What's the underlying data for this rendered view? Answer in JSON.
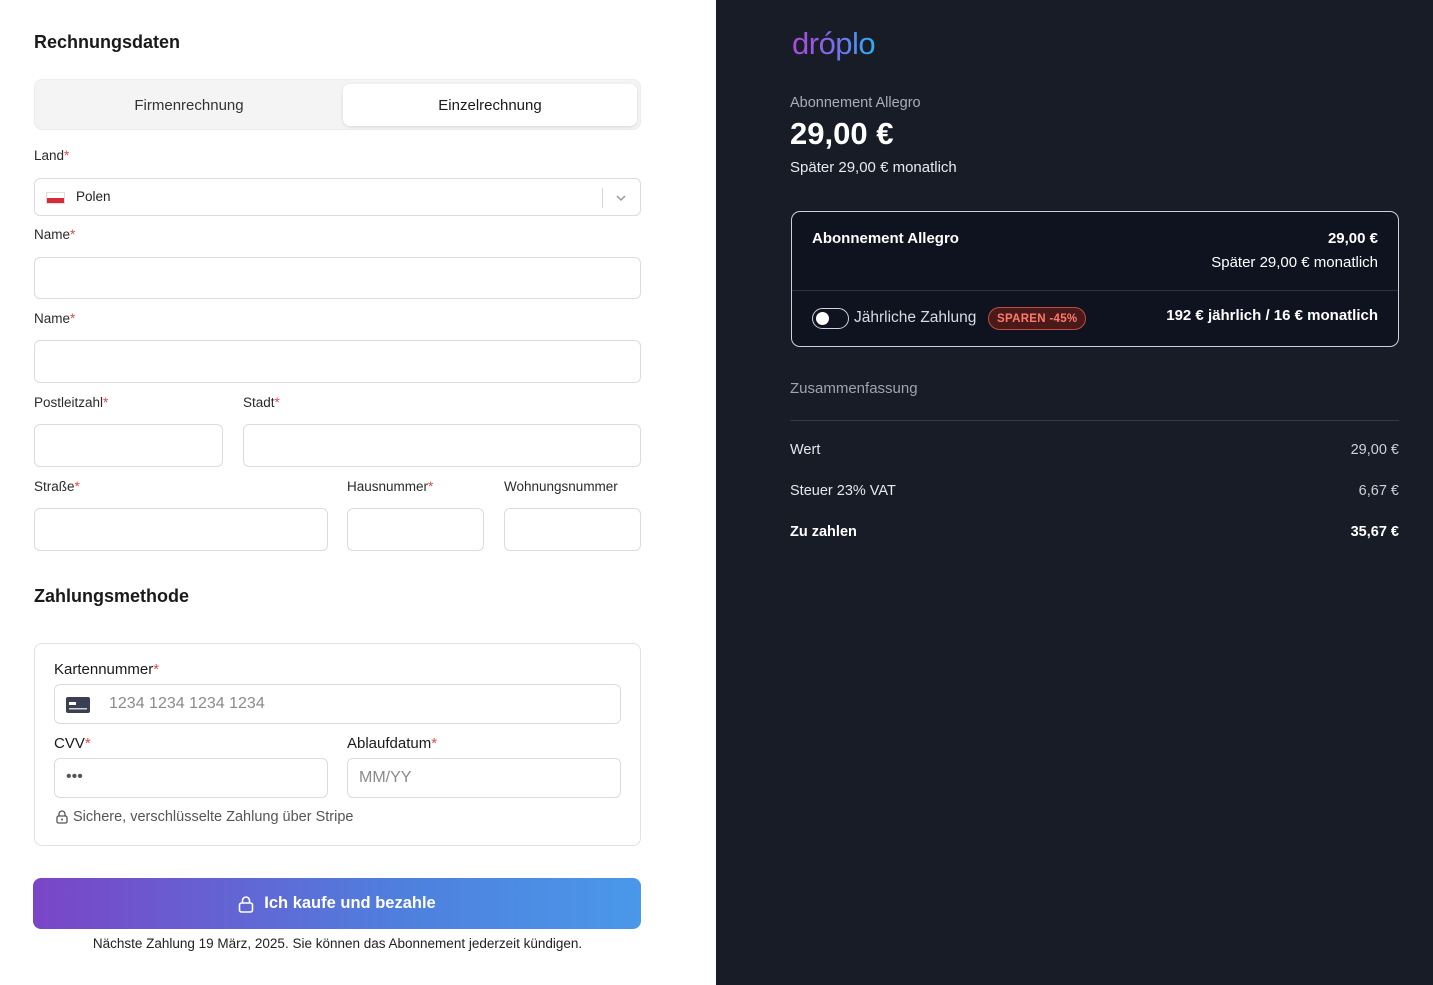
{
  "billing": {
    "title": "Rechnungsdaten",
    "tabs": [
      {
        "label": "Firmenrechnung",
        "active": false
      },
      {
        "label": "Einzelrechnung",
        "active": true
      }
    ],
    "country_label": "Land",
    "country_value": "Polen",
    "name_label_1": "Name",
    "name_label_2": "Name",
    "postal_label": "Postleitzahl",
    "city_label": "Stadt",
    "street_label": "Straße",
    "house_label": "Hausnummer",
    "apartment_label": "Wohnungsnummer",
    "required_mark": "*"
  },
  "payment": {
    "title": "Zahlungsmethode",
    "card_number_label": "Kartennummer",
    "card_number_placeholder": "1234 1234 1234 1234",
    "cvv_label": "CVV",
    "cvv_placeholder": "•••",
    "expiry_label": "Ablaufdatum",
    "expiry_placeholder": "MM/YY",
    "secure_note": "Sichere, verschlüsselte Zahlung über Stripe",
    "pay_button": "Ich kaufe und bezahle",
    "footer_note": "Nächste Zahlung 19 März, 2025. Sie können das Abonnement jederzeit kündigen."
  },
  "summary_panel": {
    "logo": "dróplo",
    "plan_name": "Abonnement Allegro",
    "price": "29,00 €",
    "later": "Später 29,00 € monatlich",
    "card": {
      "title": "Abonnement Allegro",
      "price": "29,00 €",
      "later": "Später 29,00 € monatlich",
      "annual_label": "Jährliche Zahlung",
      "badge": "SPAREN -45%",
      "annual_price": "192 € jährlich / 16 € monatlich",
      "annual_enabled": false
    },
    "summary_title": "Zusammenfassung",
    "rows": [
      {
        "label": "Wert",
        "value": "29,00 €"
      },
      {
        "label": "Steuer 23% VAT",
        "value": "6,67 €"
      },
      {
        "label": "Zu zahlen",
        "value": "35,67 €"
      }
    ]
  },
  "colors": {
    "panel_bg": "#181c27",
    "accent_start": "#7b45c7",
    "accent_end": "#4a98ea",
    "required": "#e5484d"
  }
}
